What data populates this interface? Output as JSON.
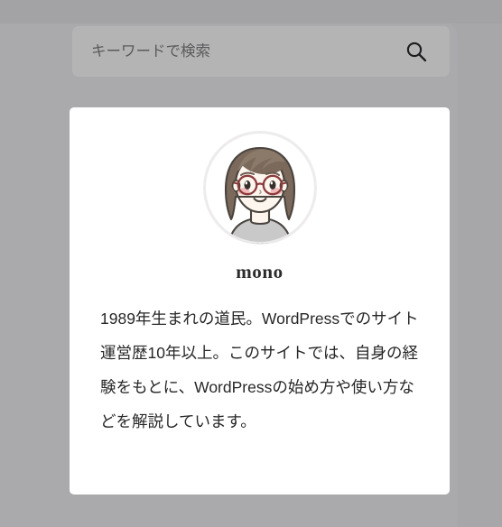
{
  "theme": {
    "page_background": "#a7a7a9",
    "panel_background": "#aaaaac",
    "top_strip": "#a3a3a5",
    "search_field_background": "#b4b4b5",
    "card_background": "#ffffff",
    "text_primary": "#272727",
    "name_color": "#2b2b2b",
    "placeholder_color": "#5a5a5c",
    "glasses_color": "#8c3c3c",
    "hair_color": "#7b6a5b",
    "skin_color": "#fdf6ee",
    "blush_color": "#f2b8bb",
    "shirt_color": "#c9c9c9"
  },
  "search": {
    "placeholder": "キーワードで検索",
    "value": "",
    "submit_icon": "search-icon",
    "submit_label": "検索"
  },
  "profile": {
    "avatar_icon": "avatar-illustration",
    "avatar_alt": "mono",
    "name": "mono",
    "bio": "1989年生まれの道民。WordPressでのサイト運営歴10年以上。このサイトでは、自身の経験をもとに、WordPressの始め方や使い方などを解説しています。"
  }
}
